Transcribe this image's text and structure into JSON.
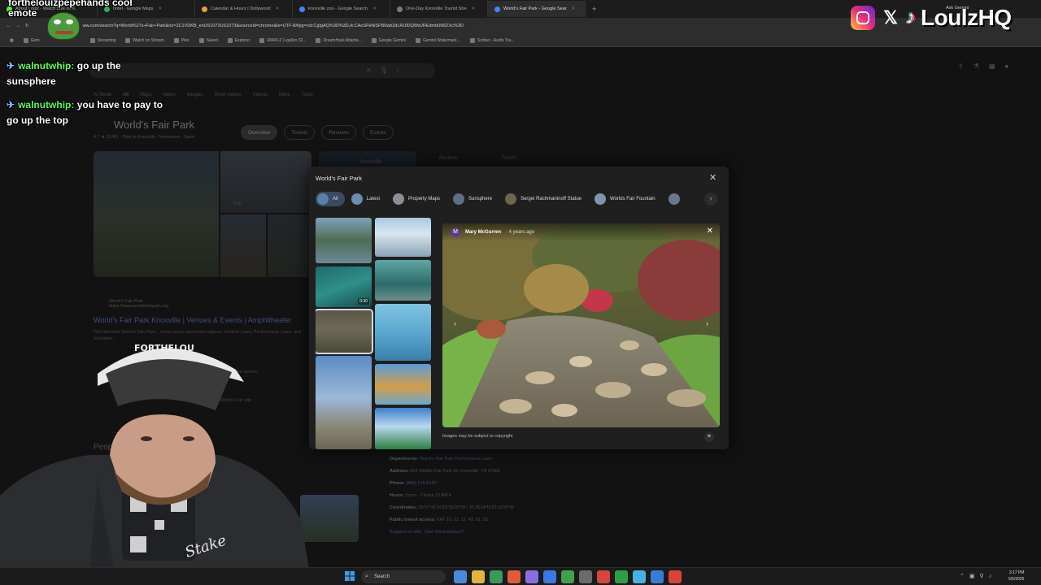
{
  "browser": {
    "tabs": [
      {
        "label": "About Loulz - Watch Live on K",
        "color": "#53fc18"
      },
      {
        "label": "hotel - Google Maps",
        "color": "#34a853"
      },
      {
        "label": "Calendar & Hours | Dollywood",
        "color": "#e0a33a"
      },
      {
        "label": "knoxville zoo - Google Search",
        "color": "#4285f4"
      },
      {
        "label": "One-Day Knoxville Tourist Stre",
        "color": "#7a7a7a"
      },
      {
        "label": "World's Fair Park - Google Sear",
        "color": "#4285f4"
      }
    ],
    "url": "ww.com/search?q=World%27s+Fair+Park&rlz=1C1VDKB_enUS1073US1073&sourceid=chrome&ie=UTF-8#lpg=cid:CgIgAQ%3D%3D,ik:CAoSFkNlSFB0wb2dLRUlDQWdJREdmb0N6ZXc%3D",
    "ask_gemini": "Ask Gemini",
    "bookmarks": [
      "Gem",
      "Streaming",
      "Watch on Stream",
      "Plex",
      "Saved",
      "Explorer",
      "RM43-2 1-gallon 32...",
      "DreamHack Atlanta...",
      "Google Gemini",
      "Gemini Watermark...",
      "Scriber - Audio Tra..."
    ]
  },
  "google": {
    "tabs": [
      "AI Mode",
      "All",
      "Maps",
      "News",
      "Images",
      "Short videos",
      "Videos",
      "More",
      "Tools"
    ],
    "place_title": "World's Fair Park",
    "rating_line": "4.7 ★ (3.8K) · Park in Knoxville, Tennessee · Open",
    "pills": [
      "Overview",
      "Tickets",
      "Reviews",
      "Events"
    ],
    "knox_label": "Knoxville",
    "right_tabs": [
      "Reviews",
      "Tickets"
    ],
    "gallery_video": "0:30",
    "result_site": "World's Fair Park",
    "result_url": "https://www.worldsfairpark.org",
    "result_title": "World's Fair Park Knoxville | Venues & Events | Amphitheater",
    "result_desc": "The historical World's Fair Park... many venue and event options. Festival Lawn, Performance Lawn, and Volunteer...",
    "result_extra_1": "event options",
    "result_extra_2": "World's Fair site",
    "people_heading": "People",
    "info": {
      "departments_label": "Departments:",
      "departments_value": "World's Fair Park Performance Lawn",
      "address_label": "Address:",
      "address_value": "963 Worlds Fair Park Dr, Knoxville, TN 37902",
      "phone_label": "Phone:",
      "phone_value": "(865) 215-8160",
      "hours_label": "Hours:",
      "hours_value": "Open · Closes 12 AM ▾",
      "coords_label": "Coordinates:",
      "coords_value": "35°57'41\"N 83°55'26\"W / 35.9614°N 83.9239°W",
      "transit_label": "Public transit access:",
      "transit_value": "KAT 10, 11, 17, 42, 81, 82",
      "suggest": "Suggest an edit · Own this business?"
    }
  },
  "modal": {
    "title": "World's Fair Park",
    "chips": [
      {
        "label": "All",
        "color": "#5b7fa8"
      },
      {
        "label": "Latest",
        "color": "#6d8bb0"
      },
      {
        "label": "Property Maps",
        "color": "#8a8f96"
      },
      {
        "label": "Sunsphere",
        "color": "#5e6e86"
      },
      {
        "label": "Sergei Rachmaninoff Statue",
        "color": "#6f6450"
      },
      {
        "label": "Worlds Fair Fountain",
        "color": "#7f95ad"
      }
    ],
    "tile_video_time": "0:30",
    "viewer": {
      "avatar_letter": "M",
      "author": "Mary McGurren",
      "time": "· 4 years ago",
      "copyright": "Images may be subject to copyright"
    }
  },
  "chat": {
    "top_line_1": "forthelouizpepehands cool",
    "top_line_2": "emote",
    "messages": [
      {
        "user": "walnutwhip:",
        "text": "go up the sunsphere"
      },
      {
        "user": "walnutwhip:",
        "text": "you have to pay to go up the top"
      }
    ]
  },
  "overlay": {
    "handle": "LoulzHQ",
    "hat_text": "FORTHELOU",
    "shirt_text": "Stake"
  },
  "taskbar": {
    "search": "Search",
    "time": "3:17 PM",
    "date": "5/5/2026",
    "app_colors": [
      "#c8a060",
      "#4a89dc",
      "#e3b341",
      "#3b9a5a",
      "#e05b3a",
      "#8a6ee0",
      "#3b78e7",
      "#3fa34d",
      "#d9453a",
      "#6b6b6b",
      "#2f9e44",
      "#48b0e5",
      "#3a7bd5",
      "#d94436"
    ]
  },
  "colors": {
    "chip_selected": "#3a4a63",
    "chat_user": "#55ff55"
  }
}
